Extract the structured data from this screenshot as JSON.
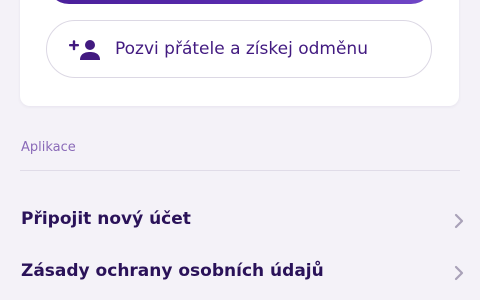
{
  "invite": {
    "label": "Pozvi přátele a získej odměnu",
    "icon": "add-person-icon"
  },
  "section": {
    "title": "Aplikace"
  },
  "items": [
    {
      "label": "Připojit nový účet",
      "icon": "chevron-right-icon"
    },
    {
      "label": "Zásady ochrany osobních údajů",
      "icon": "chevron-right-icon"
    }
  ],
  "colors": {
    "accent": "#4a1f9a",
    "label": "#421a80",
    "section": "#8a6ab8",
    "chevron": "#a9a2b8"
  }
}
